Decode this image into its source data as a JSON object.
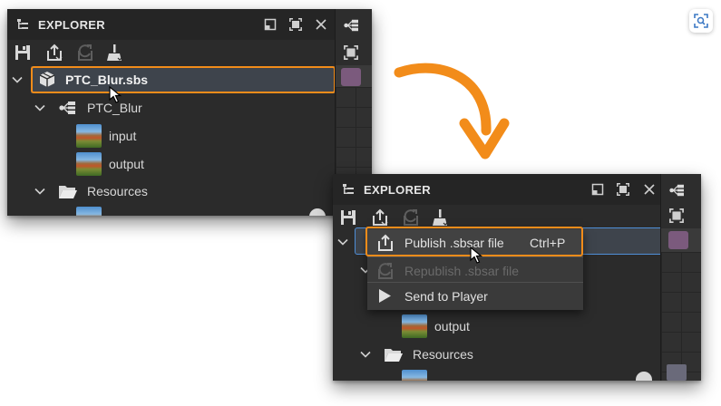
{
  "panel1": {
    "title": "EXPLORER",
    "package_label": "PTC_Blur.sbs",
    "graph_label": "PTC_Blur",
    "input_label": "input",
    "output_label": "output",
    "resources_label": "Resources"
  },
  "panel2": {
    "title": "EXPLORER",
    "output_label": "output",
    "resources_label": "Resources"
  },
  "context_menu": {
    "items": [
      {
        "label": "Publish .sbsar file",
        "shortcut": "Ctrl+P",
        "enabled": true
      },
      {
        "label": "Republish .sbsar file",
        "shortcut": "",
        "enabled": false
      },
      {
        "label": "Send to Player",
        "shortcut": "",
        "enabled": true
      }
    ]
  },
  "colors": {
    "highlight": "#f28c1a",
    "panel_bg": "#2b2b2b",
    "header_bg": "#252525",
    "selection_bg": "#444a52",
    "arrow": "#f28c1a"
  }
}
